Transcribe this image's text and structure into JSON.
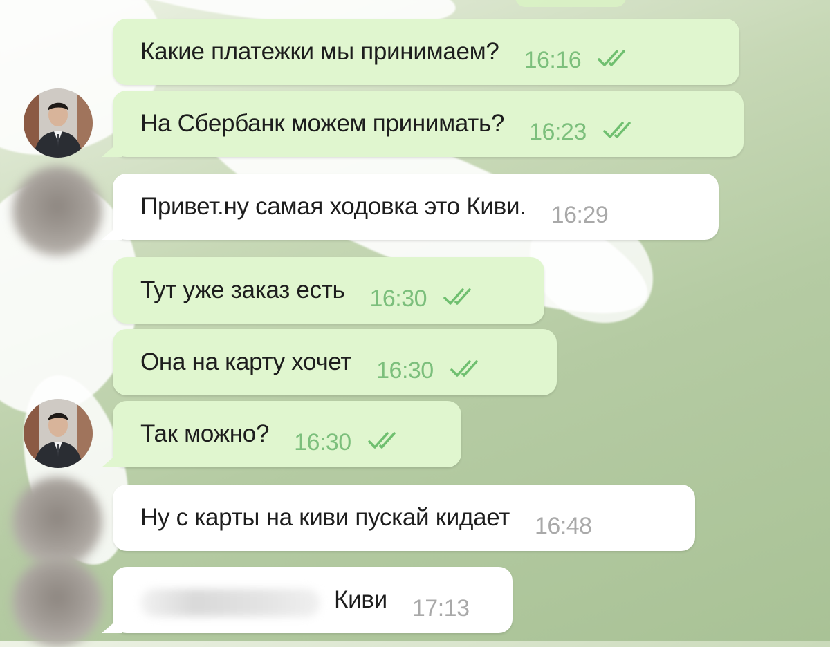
{
  "chat": {
    "messages": [
      {
        "direction": "out",
        "text": "Какие платежки мы принимаем?",
        "time": "16:16",
        "status_icon": "double-check-icon"
      },
      {
        "direction": "out",
        "text": "На Сбербанк можем принимать?",
        "time": "16:23",
        "status_icon": "double-check-icon"
      },
      {
        "direction": "in",
        "text": "Привет.ну самая ходовка это Киви.",
        "time": "16:29"
      },
      {
        "direction": "out",
        "text": "Тут уже заказ есть",
        "time": "16:30",
        "status_icon": "double-check-icon"
      },
      {
        "direction": "out",
        "text": "Она на карту хочет",
        "time": "16:30",
        "status_icon": "double-check-icon"
      },
      {
        "direction": "out",
        "text": "Так можно?",
        "time": "16:30",
        "status_icon": "double-check-icon"
      },
      {
        "direction": "in",
        "text": "Ну с карты на киви пускай кидает",
        "time": "16:48"
      },
      {
        "direction": "in",
        "text": "Киви",
        "time": "17:13"
      }
    ]
  },
  "colors": {
    "outgoing_bubble": "#e0f6cf",
    "incoming_bubble": "#ffffff",
    "read_time": "#7cbf7c",
    "incoming_time": "#a9a9a9"
  }
}
